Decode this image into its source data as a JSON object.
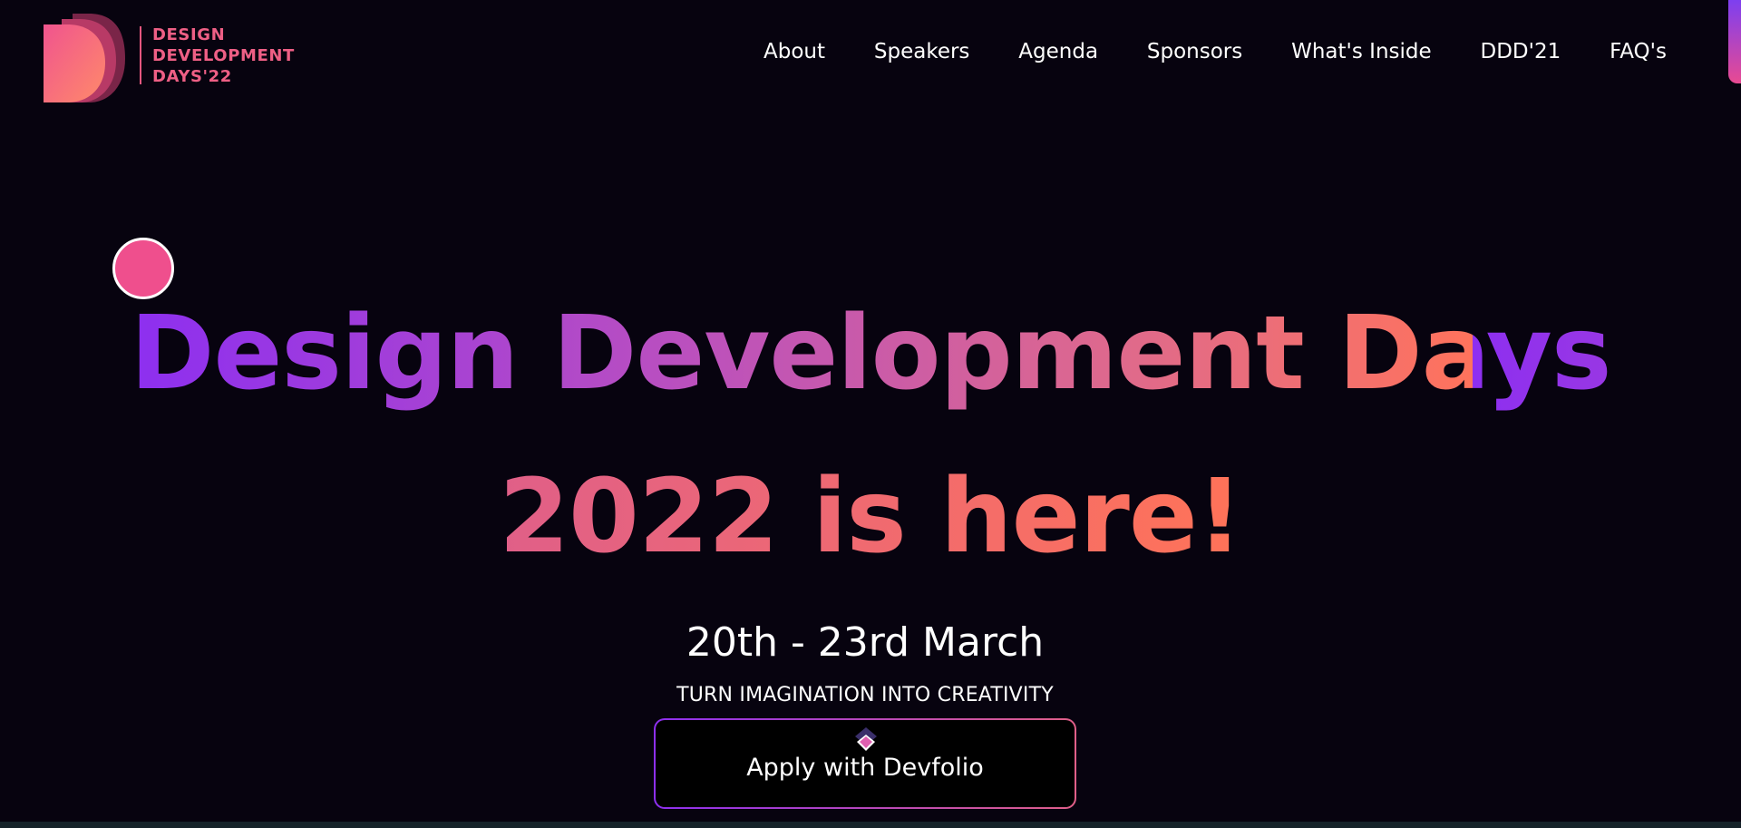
{
  "logo": {
    "line1": "DESIGN",
    "line2": "DEVELOPMENT",
    "line3": "DAYS'22"
  },
  "nav": {
    "items": [
      {
        "label": "About"
      },
      {
        "label": "Speakers"
      },
      {
        "label": "Agenda"
      },
      {
        "label": "Sponsors"
      },
      {
        "label": "What's Inside"
      },
      {
        "label": "DDD'21"
      },
      {
        "label": "FAQ's"
      }
    ]
  },
  "hero": {
    "title_line1": "Design Development Days",
    "title_line2": "2022 is here!",
    "date": "20th - 23rd March",
    "tagline": "TURN IMAGINATION INTO CREATIVITY",
    "cta_label": "Apply with Devfolio"
  },
  "icons": {
    "logo": "ddd-logo-icon",
    "cta": "devfolio-icon"
  },
  "colors": {
    "background": "#07030f",
    "brand_pink": "#ee5f85",
    "gradient_start": "#8d2ff0",
    "gradient_end": "#ff735c",
    "cursor_dot": "#ef4f8d"
  }
}
